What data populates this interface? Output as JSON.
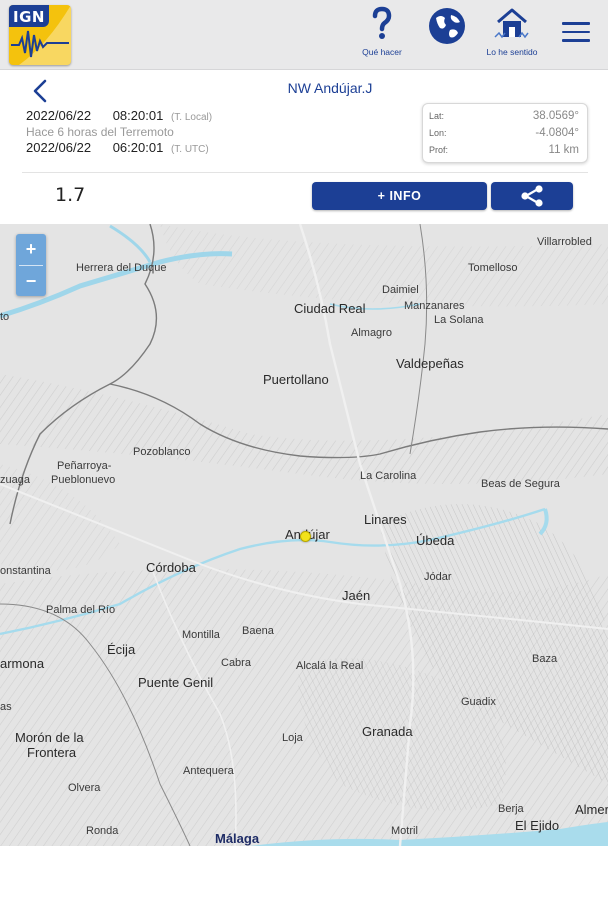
{
  "header": {
    "logo_text": "IGN",
    "actions": [
      {
        "label": "Qué hacer",
        "icon": "question-icon"
      },
      {
        "label": "",
        "icon": "globe-icon"
      },
      {
        "label": "Lo he sentido",
        "icon": "house-felt-icon"
      }
    ],
    "menu_icon": "hamburger-menu-icon",
    "colors": {
      "brand_blue": "#1c3f95",
      "logo_yellow": "#f4c20d",
      "header_bg": "#e9e9ea"
    }
  },
  "event": {
    "title": "NW Andújar.J",
    "local_date": "2022/06/22",
    "local_time": "08:20:01",
    "local_tz": "(T. Local)",
    "ago": "Hace 6 horas del Terremoto",
    "utc_date": "2022/06/22",
    "utc_time": "06:20:01",
    "utc_tz": "(T. UTC)",
    "lat_label": "Lat:",
    "lat": "38.0569°",
    "lon_label": "Lon:",
    "lon": "-4.0804°",
    "depth_label": "Prof:",
    "depth": "11 km",
    "magnitude": "1.7",
    "info_button": "+ INFO",
    "epicenter_color": "#f2e21a"
  },
  "map": {
    "zoom_in": "+",
    "zoom_out": "−",
    "places": [
      "Villarrobled",
      "Herrera del Duque",
      "Tomelloso",
      "Daimiel",
      "Ciudad Real",
      "Manzanares",
      "La Solana",
      "Almagro",
      "Valdepeñas",
      "Puertollano",
      "Pozoblanco",
      "Peñarroya-",
      "Pueblonuevo",
      "zuaga",
      "La Carolina",
      "Beas de Segura",
      "Linares",
      "Andújar",
      "Úbeda",
      "Córdoba",
      "onstantina",
      "Jódar",
      "Jaén",
      "Palma del Río",
      "Montilla",
      "Baena",
      "Écija",
      "armona",
      "Cabra",
      "Alcalá la Real",
      "Baza",
      "Puente Genil",
      "Guadix",
      "as",
      "Granada",
      "Morón de la",
      "Frontera",
      "Loja",
      "Antequera",
      "Olvera",
      "Ronda",
      "Motril",
      "Berja",
      "Almer",
      "El Ejido",
      "Málaga",
      "to"
    ]
  }
}
